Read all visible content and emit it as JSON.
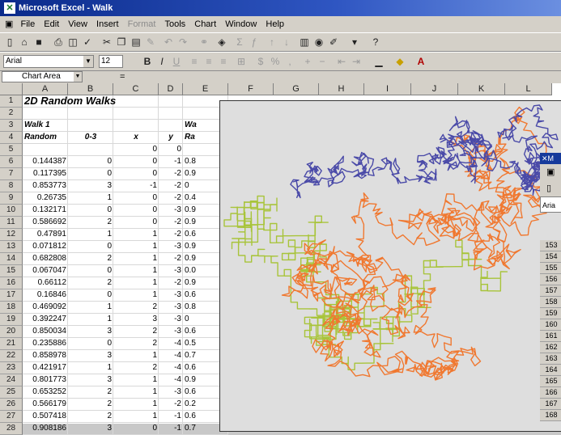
{
  "titlebar": {
    "title": "Microsoft Excel - Walk",
    "icon": "excel-icon"
  },
  "menu": [
    "File",
    "Edit",
    "View",
    "Insert",
    "Format",
    "Tools",
    "Chart",
    "Window",
    "Help"
  ],
  "format_toolbar": {
    "font": "Arial",
    "size": "12"
  },
  "formula_bar": {
    "namebox": "Chart Area",
    "equals": "="
  },
  "columns": [
    "A",
    "B",
    "C",
    "D",
    "E",
    "F",
    "G",
    "H",
    "I",
    "J",
    "K",
    "L"
  ],
  "rows": [
    "1",
    "2",
    "3",
    "4",
    "5",
    "6",
    "7",
    "8",
    "9",
    "10",
    "11",
    "12",
    "13",
    "14",
    "15",
    "16",
    "17",
    "18",
    "19",
    "20",
    "21",
    "22",
    "23",
    "24",
    "25",
    "26",
    "27",
    "28"
  ],
  "sheet": {
    "title": "2D Random Walks",
    "walk1_label": "Walk 1",
    "walk2_label": "Wa",
    "headers": {
      "random": "Random",
      "range": "0-3",
      "x": "x",
      "y": "y",
      "e": "Ra"
    },
    "row5": {
      "x": "0",
      "y": "0"
    },
    "data": [
      {
        "a": "0.144387",
        "b": "0",
        "c": "0",
        "d": "-1",
        "e": "0.8"
      },
      {
        "a": "0.117395",
        "b": "0",
        "c": "0",
        "d": "-2",
        "e": "0.9"
      },
      {
        "a": "0.853773",
        "b": "3",
        "c": "-1",
        "d": "-2",
        "e": "0"
      },
      {
        "a": "0.26735",
        "b": "1",
        "c": "0",
        "d": "-2",
        "e": "0.4"
      },
      {
        "a": "0.132171",
        "b": "0",
        "c": "0",
        "d": "-3",
        "e": "0.9"
      },
      {
        "a": "0.586692",
        "b": "2",
        "c": "0",
        "d": "-2",
        "e": "0.9"
      },
      {
        "a": "0.47891",
        "b": "1",
        "c": "1",
        "d": "-2",
        "e": "0.6"
      },
      {
        "a": "0.071812",
        "b": "0",
        "c": "1",
        "d": "-3",
        "e": "0.9"
      },
      {
        "a": "0.682808",
        "b": "2",
        "c": "1",
        "d": "-2",
        "e": "0.9"
      },
      {
        "a": "0.067047",
        "b": "0",
        "c": "1",
        "d": "-3",
        "e": "0.0"
      },
      {
        "a": "0.66112",
        "b": "2",
        "c": "1",
        "d": "-2",
        "e": "0.9"
      },
      {
        "a": "0.16846",
        "b": "0",
        "c": "1",
        "d": "-3",
        "e": "0.6"
      },
      {
        "a": "0.469092",
        "b": "1",
        "c": "2",
        "d": "-3",
        "e": "0.8"
      },
      {
        "a": "0.392247",
        "b": "1",
        "c": "3",
        "d": "-3",
        "e": "0"
      },
      {
        "a": "0.850034",
        "b": "3",
        "c": "2",
        "d": "-3",
        "e": "0.6"
      },
      {
        "a": "0.235886",
        "b": "0",
        "c": "2",
        "d": "-4",
        "e": "0.5"
      },
      {
        "a": "0.858978",
        "b": "3",
        "c": "1",
        "d": "-4",
        "e": "0.7"
      },
      {
        "a": "0.421917",
        "b": "1",
        "c": "2",
        "d": "-4",
        "e": "0.6"
      },
      {
        "a": "0.801773",
        "b": "3",
        "c": "1",
        "d": "-4",
        "e": "0.9"
      },
      {
        "a": "0.653252",
        "b": "2",
        "c": "1",
        "d": "-3",
        "e": "0.6"
      },
      {
        "a": "0.566179",
        "b": "2",
        "c": "1",
        "d": "-2",
        "e": "0.2"
      },
      {
        "a": "0.507418",
        "b": "2",
        "c": "1",
        "d": "-1",
        "e": "0.6"
      },
      {
        "a": "0.908186",
        "b": "3",
        "c": "0",
        "d": "-1",
        "e": "0.7"
      }
    ]
  },
  "overlay_rows": [
    "153",
    "154",
    "155",
    "156",
    "157",
    "158",
    "159",
    "160",
    "161",
    "162",
    "163",
    "164",
    "165",
    "166",
    "167",
    "168"
  ],
  "overlay_font": "Aria",
  "overlay_title": "M",
  "colors": {
    "walk1": "#4a4aa8",
    "walk2": "#f07830",
    "walk3": "#a8c43a",
    "title_bar": "#0a2a8a"
  }
}
